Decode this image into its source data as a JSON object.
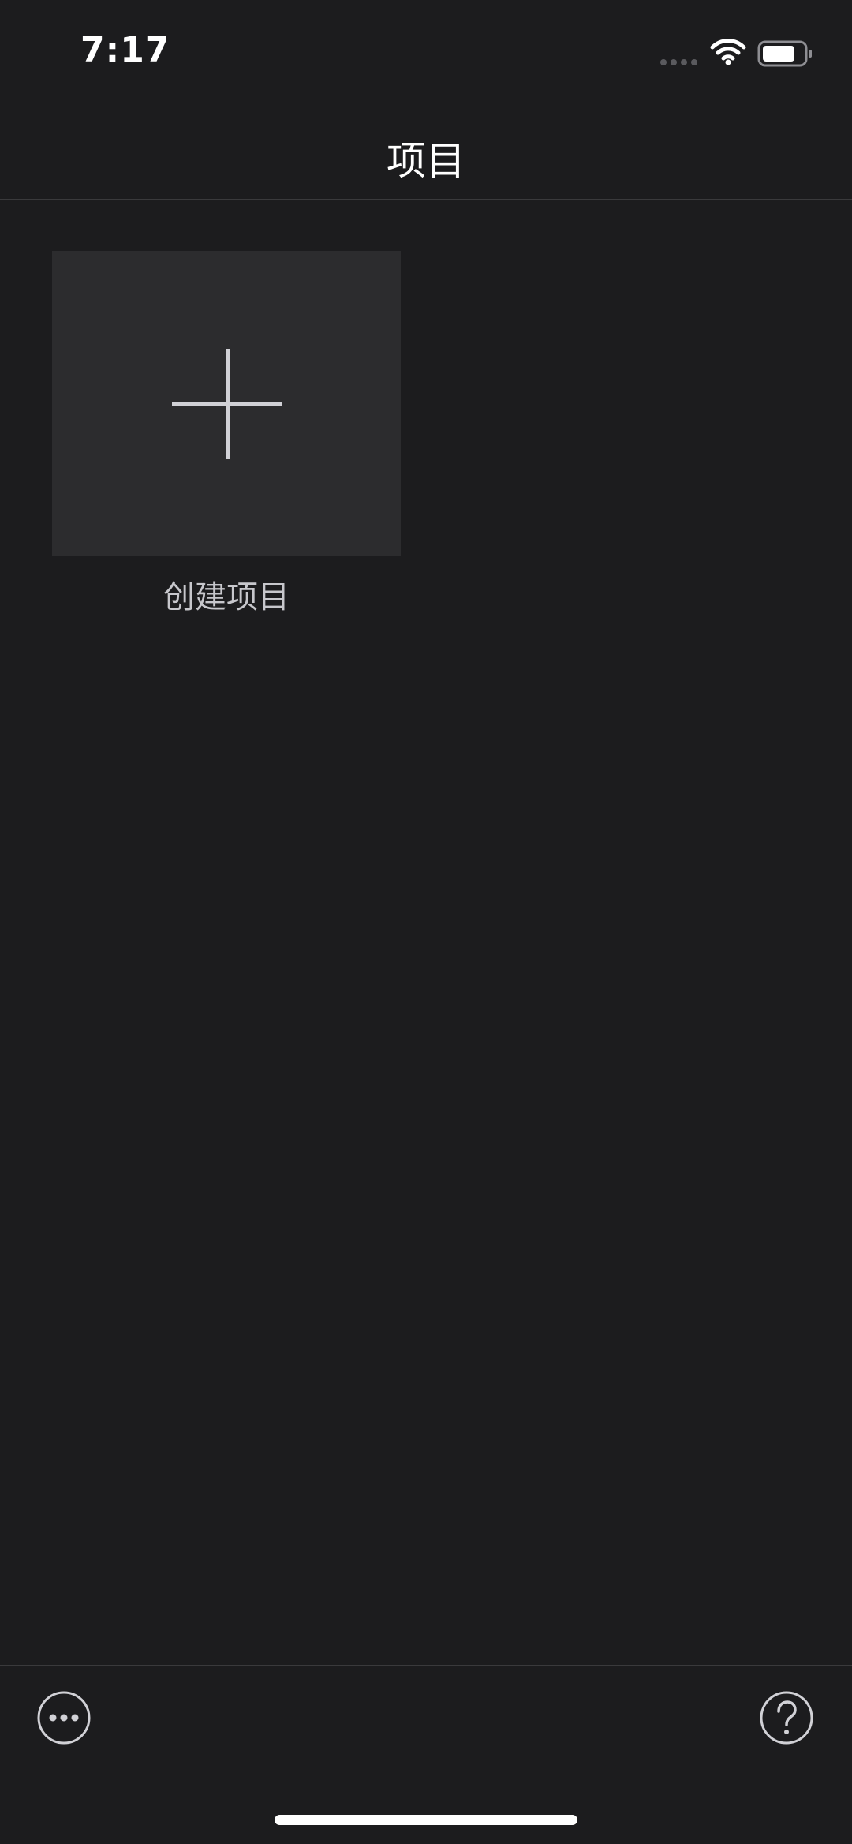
{
  "status_bar": {
    "time": "7:17",
    "signal_icon": "signal-dots-icon",
    "wifi_icon": "wifi-icon",
    "battery_icon": "battery-icon",
    "battery_level": 0.8
  },
  "nav": {
    "title": "项目"
  },
  "projects": {
    "create_label": "创建项目",
    "create_icon": "plus-icon"
  },
  "toolbar": {
    "more_icon": "more-icon",
    "help_icon": "help-icon"
  },
  "colors": {
    "background": "#1c1c1e",
    "tile": "#2c2c2e",
    "separator": "#3a3a3c",
    "text_primary": "#ffffff",
    "text_secondary": "#c7c7cc"
  }
}
